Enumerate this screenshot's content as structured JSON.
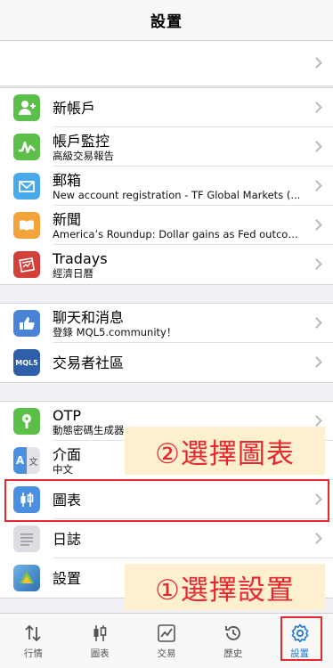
{
  "header": {
    "title": "設置"
  },
  "rows": {
    "new_account": {
      "label": "新帳戶"
    },
    "account_monitor": {
      "label": "帳戶監控",
      "sub": "高級交易報告"
    },
    "mailbox": {
      "label": "郵箱",
      "sub": "New account registration - TF Global Markets (..."
    },
    "news": {
      "label": "新聞",
      "sub": "America’s Roundup: Dollar gains as Fed outcom..."
    },
    "tradays": {
      "label": "Tradays",
      "sub": "經濟日曆"
    },
    "chat": {
      "label": "聊天和消息",
      "sub": "登錄 MQL5.community！"
    },
    "community": {
      "label": "交易者社區"
    },
    "otp": {
      "label": "OTP",
      "sub": "動態密碼生成器"
    },
    "interface": {
      "label": "介面",
      "sub": "中文"
    },
    "charts": {
      "label": "圖表"
    },
    "journal": {
      "label": "日誌"
    },
    "settings": {
      "label": "設置"
    }
  },
  "annotations": {
    "step2": "②選擇圖表",
    "step1": "①選擇設置"
  },
  "icons": {
    "mql5_text": "MQL5",
    "interface_icon_text": "A",
    "interface_icon_text2": "文"
  },
  "tabbar": {
    "quotes": "行情",
    "chart": "圖表",
    "trade": "交易",
    "history": "歷史",
    "settings": "設置"
  },
  "colors": {
    "accent": "#1e78d2",
    "annotation_red": "#e8262e",
    "annotation_bg": "#fcf0cf"
  }
}
